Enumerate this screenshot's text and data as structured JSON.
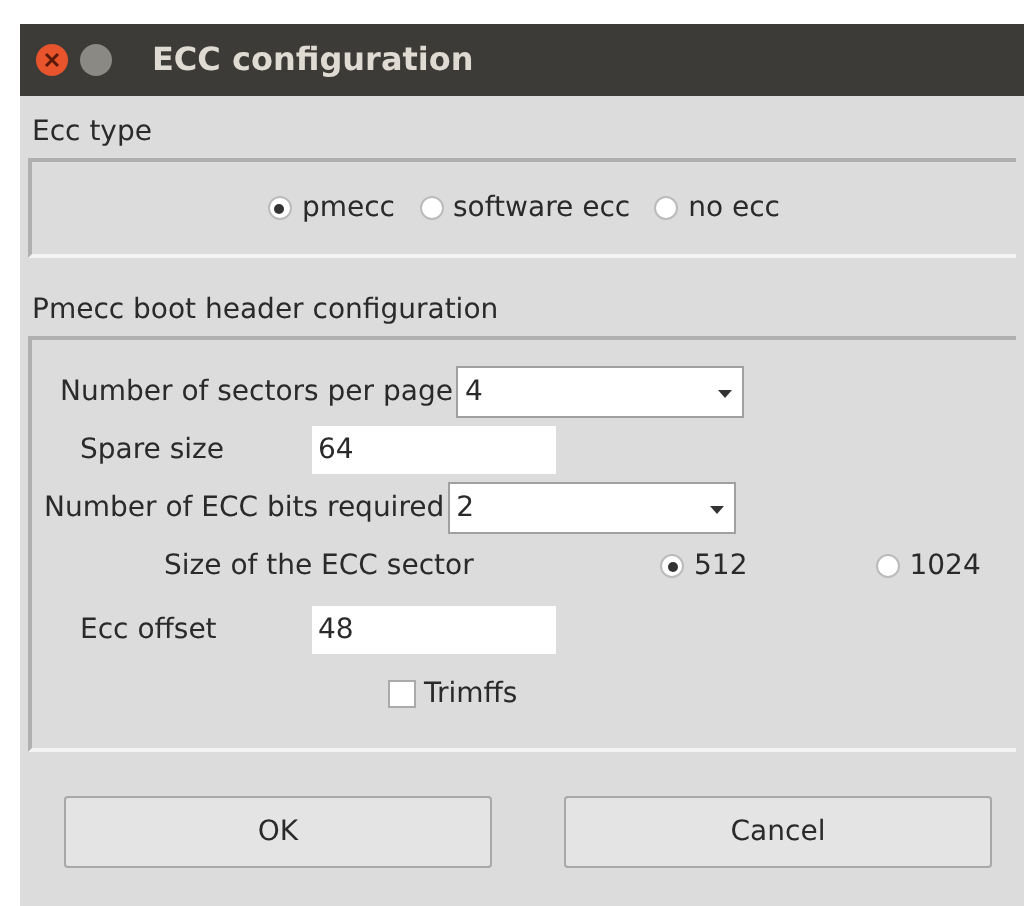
{
  "window": {
    "title": "ECC configuration"
  },
  "ecc_type": {
    "label": "Ecc type",
    "options": [
      {
        "label": "pmecc",
        "selected": true
      },
      {
        "label": "software ecc",
        "selected": false
      },
      {
        "label": "no ecc",
        "selected": false
      }
    ]
  },
  "pmecc": {
    "label": "Pmecc boot header configuration",
    "sectors_per_page": {
      "label": "Number of sectors per page",
      "value": "4"
    },
    "spare_size": {
      "label": "Spare size",
      "value": "64"
    },
    "ecc_bits": {
      "label": "Number of ECC bits required",
      "value": "2"
    },
    "sector_size": {
      "label": "Size of the ECC sector",
      "options": [
        {
          "label": "512",
          "selected": true
        },
        {
          "label": "1024",
          "selected": false
        }
      ]
    },
    "ecc_offset": {
      "label": "Ecc offset",
      "value": "48"
    },
    "trimffs": {
      "label": "Trimffs",
      "checked": false
    }
  },
  "buttons": [
    "OK",
    "Cancel"
  ]
}
